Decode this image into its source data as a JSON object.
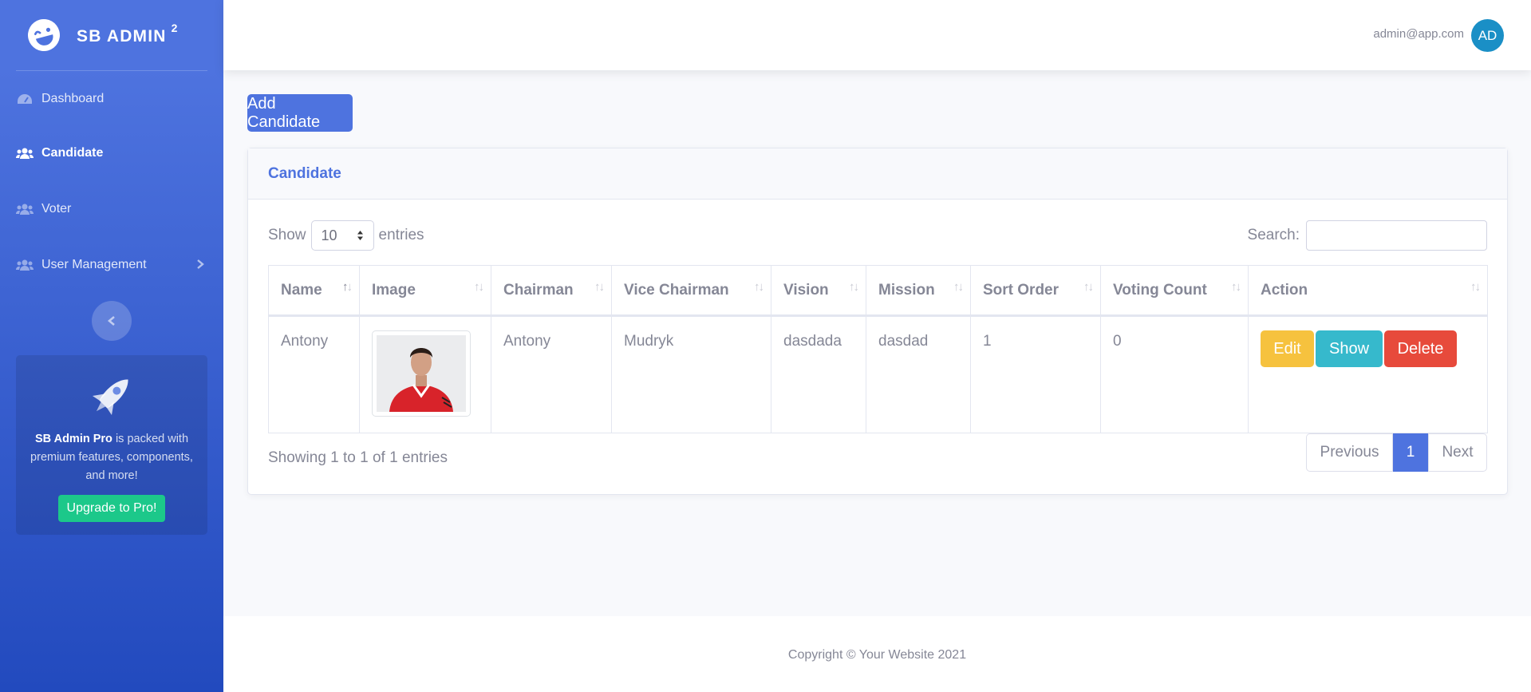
{
  "brand": {
    "name": "SB ADMIN",
    "sup": "2"
  },
  "sidebar": {
    "items": [
      {
        "label": "Dashboard",
        "icon": "tachometer-icon"
      },
      {
        "label": "Candidate",
        "icon": "users-icon",
        "active": true
      },
      {
        "label": "Voter",
        "icon": "users-icon"
      },
      {
        "label": "User Management",
        "icon": "users-icon",
        "has_submenu": true
      }
    ],
    "promo": {
      "strong": "SB Admin Pro",
      "text": " is packed with premium features, components, and more!",
      "button": "Upgrade to Pro!"
    }
  },
  "topbar": {
    "email": "admin@app.com",
    "avatar_initials": "AD"
  },
  "page": {
    "add_button": "Add Candidate",
    "card_title": "Candidate",
    "length": {
      "show": "Show",
      "value": "10",
      "entries": "entries"
    },
    "search_label": "Search:",
    "columns": [
      "Name",
      "Image",
      "Chairman",
      "Vice Chairman",
      "Vision",
      "Mission",
      "Sort Order",
      "Voting Count",
      "Action"
    ],
    "rows": [
      {
        "name": "Antony",
        "chairman": "Antony",
        "vice_chairman": "Mudryk",
        "vision": "dasdada",
        "mission": "dasdad",
        "sort_order": "1",
        "voting_count": "0"
      }
    ],
    "actions": {
      "edit": "Edit",
      "show": "Show",
      "delete": "Delete"
    },
    "info": "Showing 1 to 1 of 1 entries",
    "pager": {
      "previous": "Previous",
      "current": "1",
      "next": "Next"
    }
  },
  "footer": {
    "copyright": "Copyright © Your Website 2021"
  },
  "colors": {
    "primary": "#4e73df",
    "success": "#1cc88a",
    "warning": "#f6c23e",
    "info": "#36b9cc",
    "danger": "#e74a3b"
  }
}
